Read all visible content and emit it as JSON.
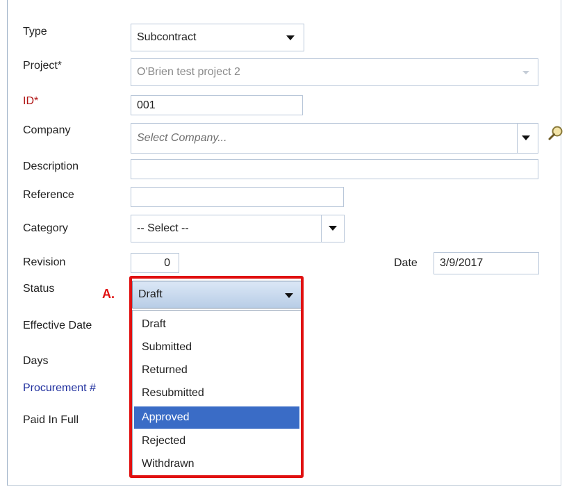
{
  "form": {
    "type": {
      "label": "Type",
      "value": "Subcontract"
    },
    "project": {
      "label": "Project*",
      "value": "O'Brien test project 2"
    },
    "id": {
      "label": "ID*",
      "value": "001"
    },
    "company": {
      "label": "Company",
      "placeholder": "Select Company..."
    },
    "description": {
      "label": "Description",
      "value": ""
    },
    "reference": {
      "label": "Reference",
      "value": ""
    },
    "category": {
      "label": "Category",
      "value": "-- Select --"
    },
    "revision": {
      "label": "Revision",
      "value": "0"
    },
    "date": {
      "label": "Date",
      "value": "3/9/2017"
    },
    "status": {
      "label": "Status",
      "value": "Draft",
      "options": [
        "Draft",
        "Submitted",
        "Returned",
        "Resubmitted",
        "Approved",
        "Rejected",
        "Withdrawn"
      ],
      "highlighted_option": "Approved"
    },
    "effective_date": {
      "label": "Effective Date"
    },
    "days": {
      "label": "Days"
    },
    "procurement": {
      "label": "Procurement #"
    },
    "paid_in_full": {
      "label": "Paid In Full"
    }
  },
  "annotation": {
    "label": "A.",
    "color": "#e01010"
  },
  "colors": {
    "selected_option": "#3a6cc6",
    "required_label": "#b01515",
    "link_label": "#1f2f9e"
  },
  "icons": {
    "company_lookup": "magnifier-icon",
    "dropdown": "chevron-down-icon"
  }
}
